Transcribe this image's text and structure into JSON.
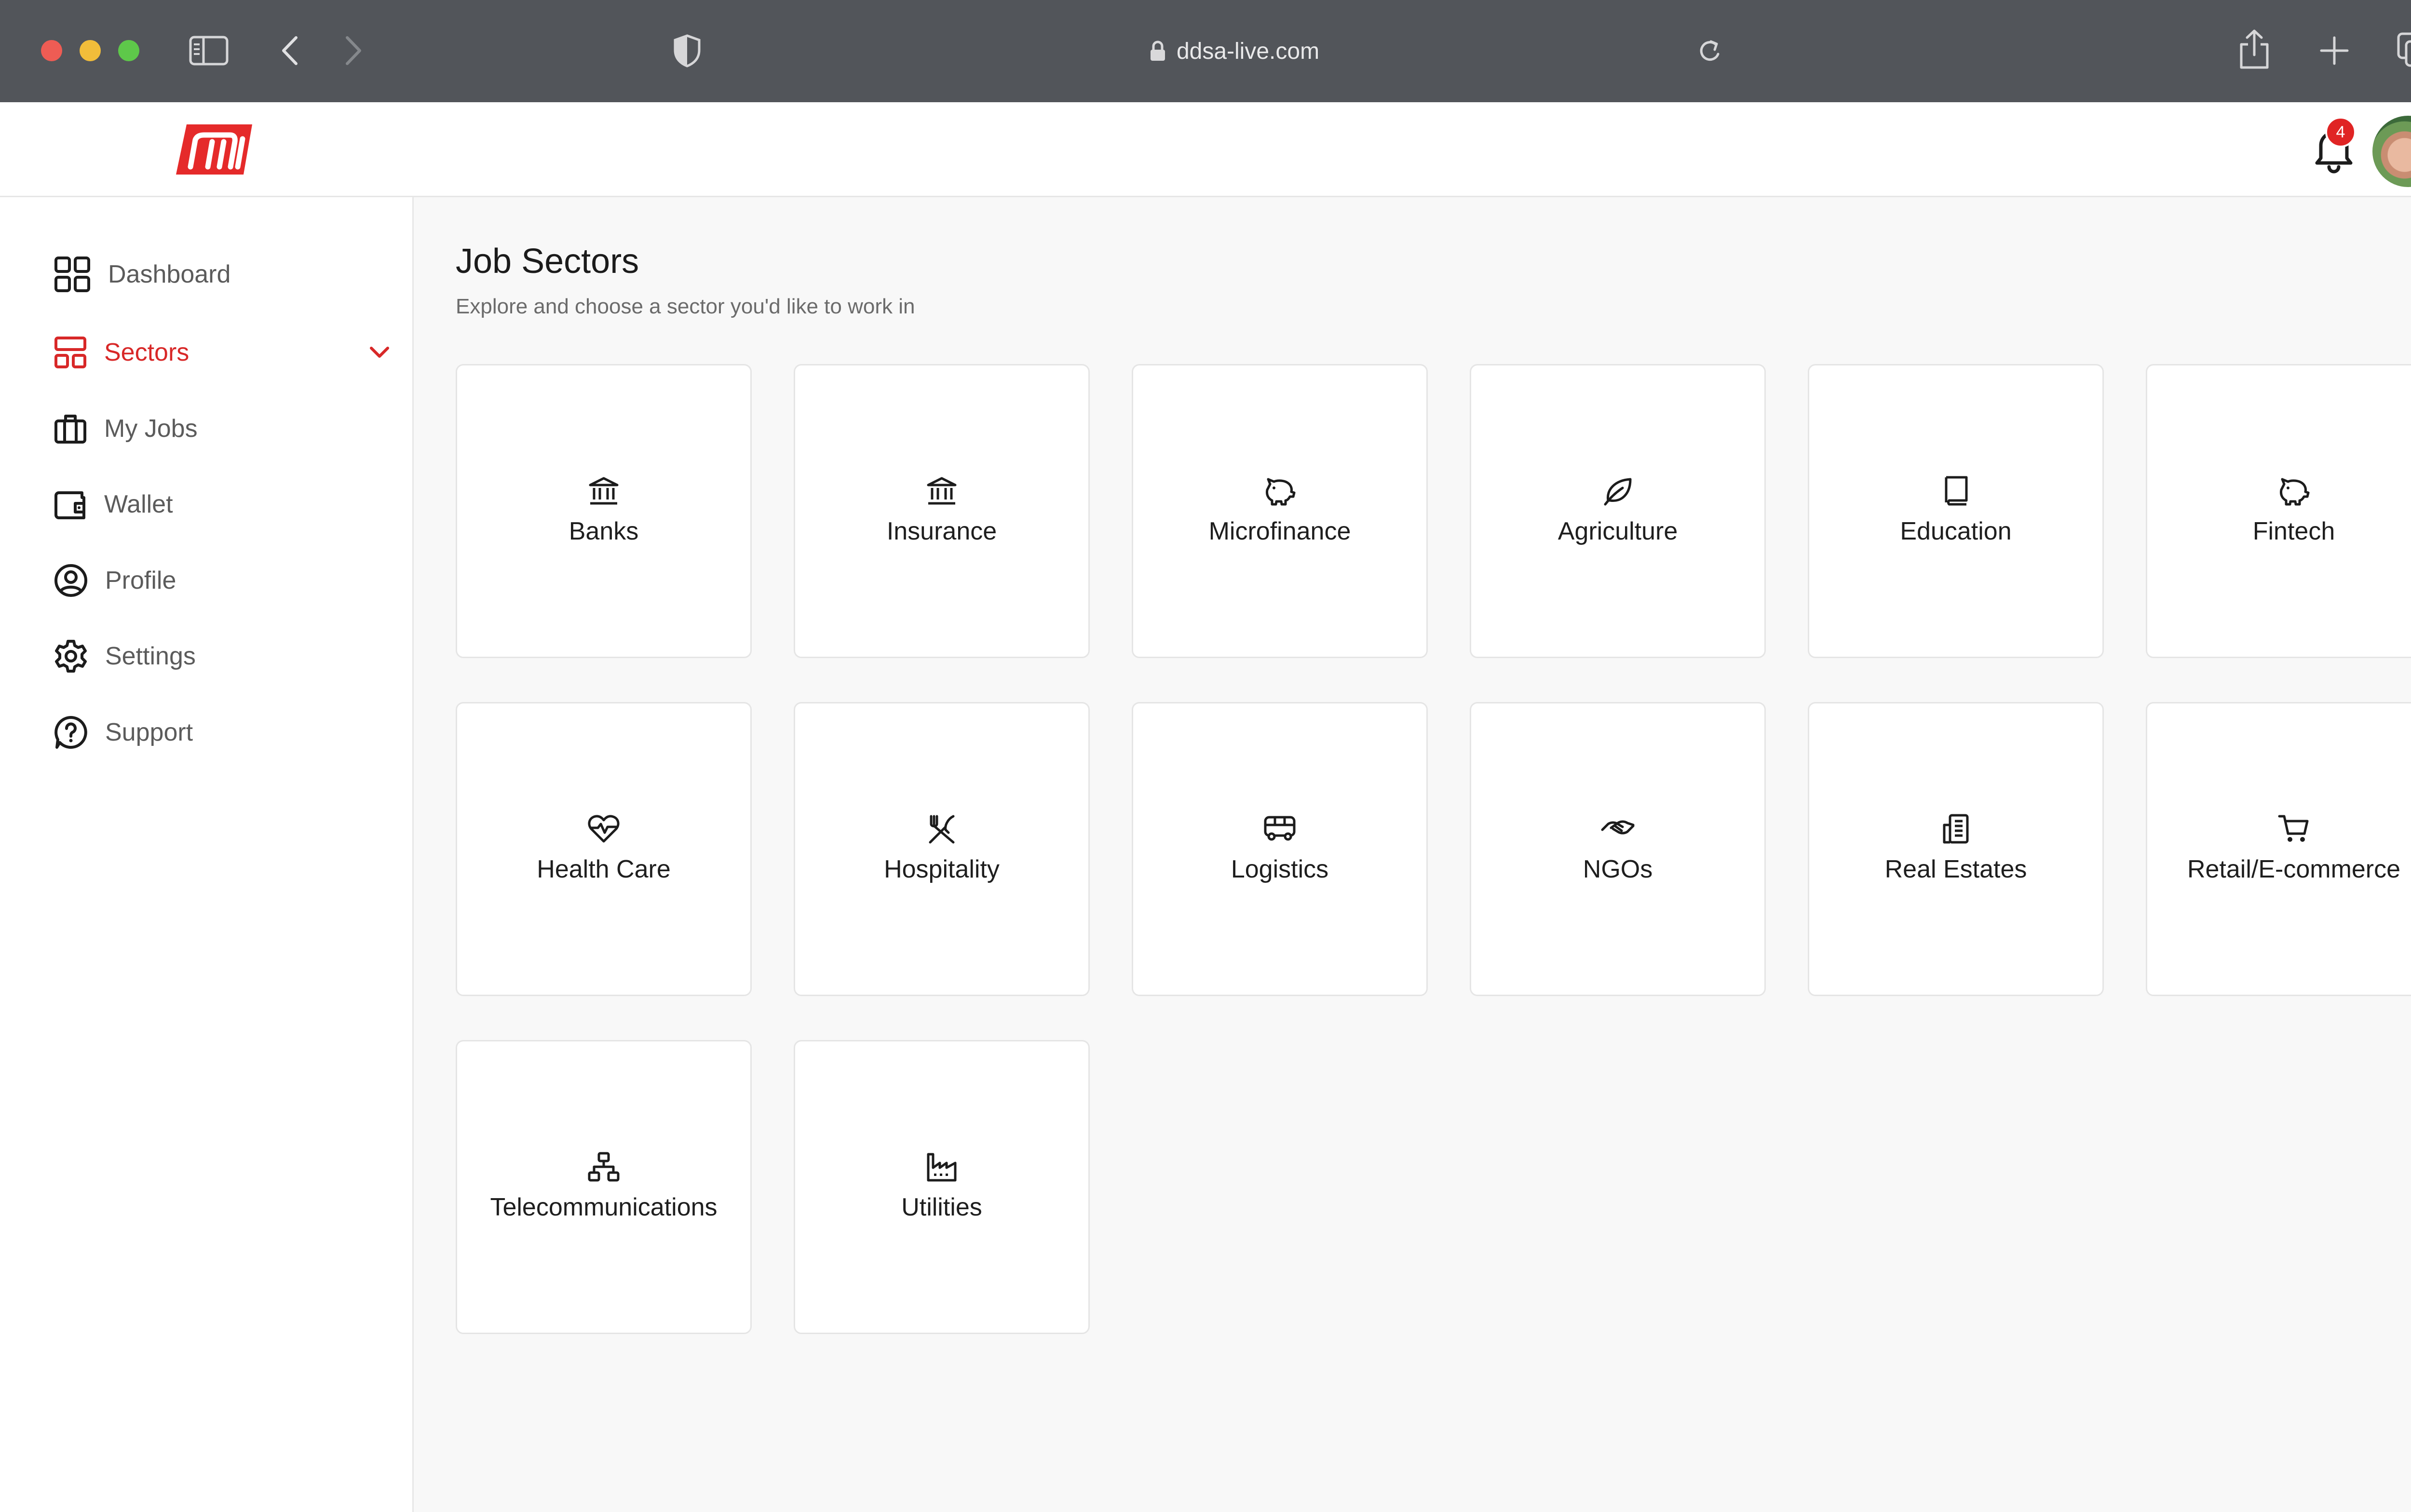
{
  "browser": {
    "url": "ddsa-live.com"
  },
  "header": {
    "notification_count": "4"
  },
  "sidebar": {
    "items": [
      {
        "label": "Dashboard"
      },
      {
        "label": "Sectors"
      },
      {
        "label": "My Jobs"
      },
      {
        "label": "Wallet"
      },
      {
        "label": "Profile"
      },
      {
        "label": "Settings"
      },
      {
        "label": "Support"
      }
    ]
  },
  "main": {
    "title": "Job Sectors",
    "subtitle": "Explore and choose a sector you'd like to work in",
    "sectors": [
      {
        "label": "Banks",
        "icon": "bank-icon"
      },
      {
        "label": "Insurance",
        "icon": "bank-icon"
      },
      {
        "label": "Microfinance",
        "icon": "piggy-bank-icon"
      },
      {
        "label": "Agriculture",
        "icon": "leaf-icon"
      },
      {
        "label": "Education",
        "icon": "book-icon"
      },
      {
        "label": "Fintech",
        "icon": "piggy-bank-icon"
      },
      {
        "label": "Health Care",
        "icon": "heart-pulse-icon"
      },
      {
        "label": "Hospitality",
        "icon": "utensils-icon"
      },
      {
        "label": "Logistics",
        "icon": "bus-icon"
      },
      {
        "label": "NGOs",
        "icon": "handshake-icon"
      },
      {
        "label": "Real Estates",
        "icon": "building-icon"
      },
      {
        "label": "Retail/E-commerce",
        "icon": "cart-icon"
      },
      {
        "label": "Telecommunications",
        "icon": "network-icon"
      },
      {
        "label": "Utilities",
        "icon": "factory-icon"
      }
    ]
  },
  "colors": {
    "accent": "#d82828",
    "chrome": "#52555a",
    "background": "#f8f8f8"
  }
}
